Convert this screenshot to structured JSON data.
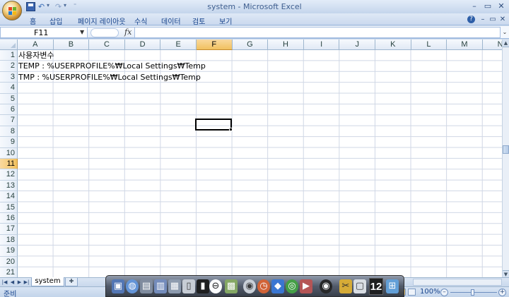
{
  "window": {
    "title": "system - Microsoft Excel",
    "minimize": "–",
    "restore": "▭",
    "close": "✕"
  },
  "ribbon": {
    "tabs": [
      "홈",
      "삽입",
      "페이지 레이아웃",
      "수식",
      "데이터",
      "검토",
      "보기"
    ],
    "help": "?",
    "min": "–",
    "restore": "▭",
    "close": "✕"
  },
  "formula_bar": {
    "name_box": "F11",
    "fx": "fx",
    "content": ""
  },
  "sheet": {
    "columns": [
      "A",
      "B",
      "C",
      "D",
      "E",
      "F",
      "G",
      "H",
      "I",
      "J",
      "K",
      "L",
      "M",
      "N"
    ],
    "rows": [
      "1",
      "2",
      "3",
      "4",
      "5",
      "6",
      "7",
      "8",
      "9",
      "10",
      "11",
      "12",
      "13",
      "14",
      "15",
      "16",
      "17",
      "18",
      "19",
      "20",
      "21"
    ],
    "selected_column": "F",
    "selected_row": "11",
    "cells": {
      "A1": "사용자변수",
      "A2": "TEMP : %USERPROFILE%₩Local Settings₩Temp",
      "A3": "TMP  : %USERPROFILE%₩Local Settings₩Temp"
    },
    "tab_name": "system"
  },
  "status": {
    "ready": "준비",
    "zoom": "100%"
  },
  "dock": {
    "clock_badge": "12"
  },
  "colors": {
    "accent": "#15428b",
    "selection": "#f1c15f",
    "gridline": "#d0d7e5"
  }
}
